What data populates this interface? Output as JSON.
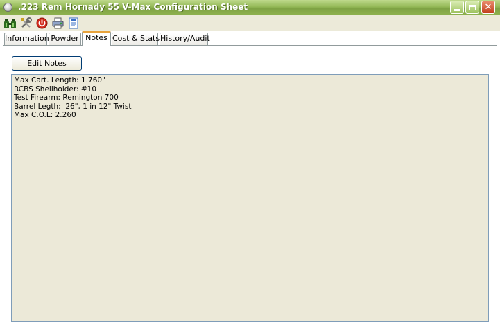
{
  "window": {
    "title": ".223 Rem Hornady 55 V-Max Configuration Sheet",
    "controls": {
      "minimize": "minimize",
      "maximize": "maximize",
      "close": "✕"
    }
  },
  "toolbar": {
    "buttons": [
      {
        "icon": "binoculars-icon",
        "color": "#2e6b1f"
      },
      {
        "icon": "tools-icon",
        "color": "#7a7a7a"
      },
      {
        "icon": "power-icon",
        "color": "#d22a1c"
      },
      {
        "icon": "printer-icon",
        "color": "#5a6f9a"
      },
      {
        "icon": "document-icon",
        "color": "#3a6fc4"
      }
    ]
  },
  "tabs": [
    {
      "label": "Information",
      "active": false
    },
    {
      "label": "Powder",
      "active": false
    },
    {
      "label": "Notes",
      "active": true
    },
    {
      "label": "Cost & Stats",
      "active": false
    },
    {
      "label": "History/Audit",
      "active": false
    }
  ],
  "notes_tab": {
    "edit_button_label": "Edit Notes",
    "lines": [
      "Max Cart. Length: 1.760\"",
      "RCBS Shellholder: #10",
      "Test Firearm: Remington 700",
      "Barrel Legth:  26\", 1 in 12\" Twist",
      "Max C.O.L: 2.260"
    ]
  },
  "colors": {
    "titlebar": "#93b856",
    "panel_background": "#ece9d8",
    "active_tab_accent": "#e8a33c"
  }
}
